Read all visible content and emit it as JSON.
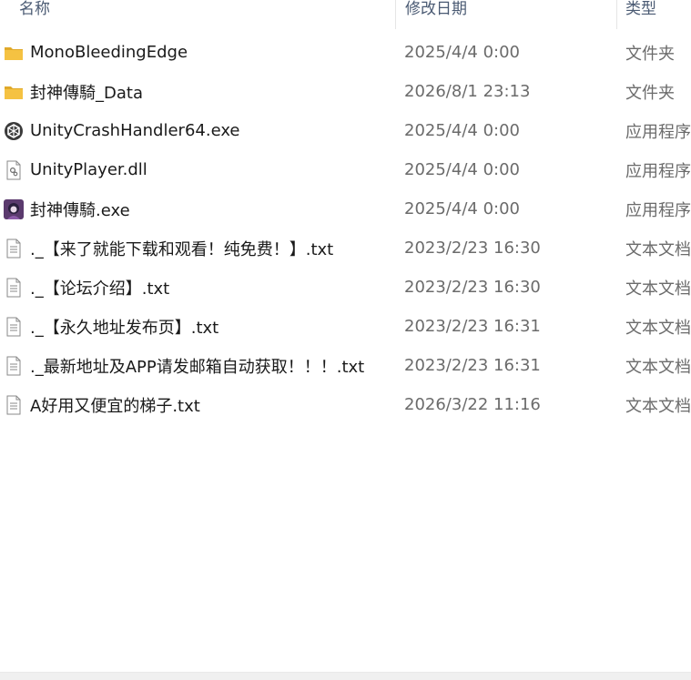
{
  "columns": {
    "name": "名称",
    "date": "修改日期",
    "type": "类型"
  },
  "files": [
    {
      "name": "MonoBleedingEdge",
      "date": "2025/4/4 0:00",
      "type": "文件夹",
      "icon": "folder-icon"
    },
    {
      "name": "封神傳騎_Data",
      "date": "2026/8/1 23:13",
      "type": "文件夹",
      "icon": "folder-icon"
    },
    {
      "name": "UnityCrashHandler64.exe",
      "date": "2025/4/4 0:00",
      "type": "应用程序",
      "icon": "unity-app-icon"
    },
    {
      "name": "UnityPlayer.dll",
      "date": "2025/4/4 0:00",
      "type": "应用程序",
      "icon": "dll-file-icon"
    },
    {
      "name": "封神傳騎.exe",
      "date": "2025/4/4 0:00",
      "type": "应用程序",
      "icon": "game-app-icon"
    },
    {
      "name": "._【来了就能下载和观看！纯免费！】.txt",
      "date": "2023/2/23 16:30",
      "type": "文本文档",
      "icon": "text-file-icon"
    },
    {
      "name": "._【论坛介绍】.txt",
      "date": "2023/2/23 16:30",
      "type": "文本文档",
      "icon": "text-file-icon"
    },
    {
      "name": "._【永久地址发布页】.txt",
      "date": "2023/2/23 16:31",
      "type": "文本文档",
      "icon": "text-file-icon"
    },
    {
      "name": "._最新地址及APP请发邮箱自动获取！！！.txt",
      "date": "2023/2/23 16:31",
      "type": "文本文档",
      "icon": "text-file-icon"
    },
    {
      "name": "A好用又便宜的梯子.txt",
      "date": "2026/3/22 11:16",
      "type": "文本文档",
      "icon": "text-file-icon"
    }
  ],
  "colors": {
    "folder": "#f5c242",
    "folder_dark": "#e0a92a",
    "text_primary": "#1a1a1a",
    "text_secondary": "#6b6b6b",
    "header_text": "#4a5a73"
  }
}
